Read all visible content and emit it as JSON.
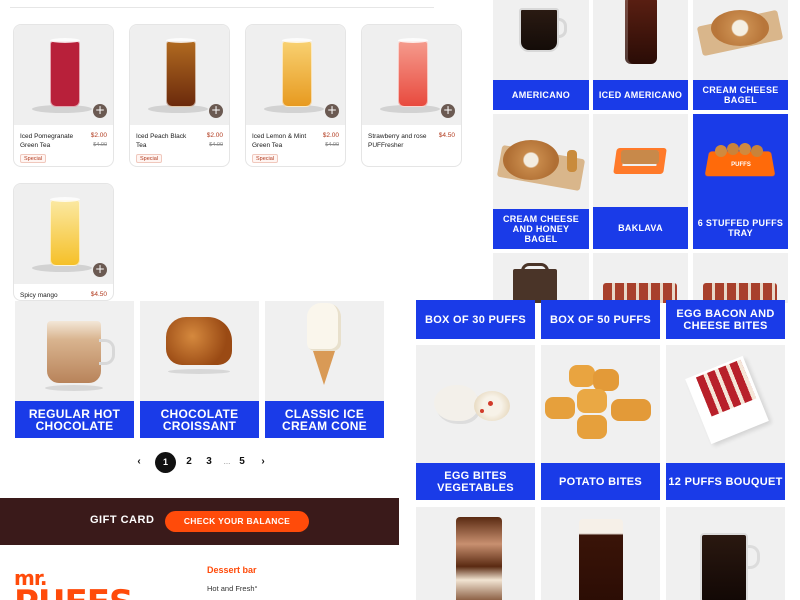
{
  "drinks": [
    {
      "name": "Iced Pomegranate Green Tea",
      "price": "$2.00",
      "old_price": "$4.00",
      "badge": "Special",
      "color": "#b8203a"
    },
    {
      "name": "Iced Peach Black Tea",
      "price": "$2.00",
      "old_price": "$4.00",
      "badge": "Special",
      "color": "#8c3c12"
    },
    {
      "name": "Iced Lemon & Mint Green Tea",
      "price": "$2.00",
      "old_price": "$4.00",
      "badge": "Special",
      "color": "#f0b030"
    },
    {
      "name": "Strawberry and rose PUFFresher",
      "price": "$4.50",
      "color": "#ef6b62"
    },
    {
      "name": "Spicy mango",
      "price": "$4.50",
      "color": "#f5c028"
    }
  ],
  "add_symbol": "+",
  "left_tiles": [
    {
      "label": "REGULAR HOT CHOCOLATE"
    },
    {
      "label": "CHOCOLATE CROISSANT"
    },
    {
      "label": "CLASSIC ICE CREAM CONE"
    }
  ],
  "right_tiles_top": [
    {
      "label": "AMERICANO"
    },
    {
      "label": "ICED AMERICANO"
    },
    {
      "label": "CREAM CHEESE BAGEL"
    },
    {
      "label": "CREAM CHEESE AND HONEY BAGEL"
    },
    {
      "label": "BAKLAVA"
    },
    {
      "label": "6 STUFFED PUFFS TRAY"
    }
  ],
  "right_tiles_mid": [
    {
      "label": "BOX OF 30 PUFFS"
    },
    {
      "label": "BOX OF 50 PUFFS"
    },
    {
      "label": "EGG BACON AND CHEESE BITES"
    },
    {
      "label": "EGG BITES VEGETABLES"
    },
    {
      "label": "POTATO BITES"
    },
    {
      "label": "12 PUFFS BOUQUET"
    }
  ],
  "puffs_tray_brand": "PUFFS",
  "pagination": {
    "prev": "‹",
    "current": "1",
    "pages": [
      "2",
      "3"
    ],
    "ellipsis": "...",
    "last": "5",
    "next": "›"
  },
  "gift_card": {
    "title": "GIFT CARD",
    "button": "CHECK YOUR BALANCE"
  },
  "footer": {
    "logo_top": "mr.",
    "logo_bottom": "PUFFS",
    "heading": "Dessert bar",
    "text": "Hot and Fresh°"
  },
  "colors": {
    "accent_blue": "#1a3be8",
    "brand_orange": "#ff4b0a",
    "gift_bar": "#3a1a1a",
    "price_red": "#b13a1e"
  }
}
